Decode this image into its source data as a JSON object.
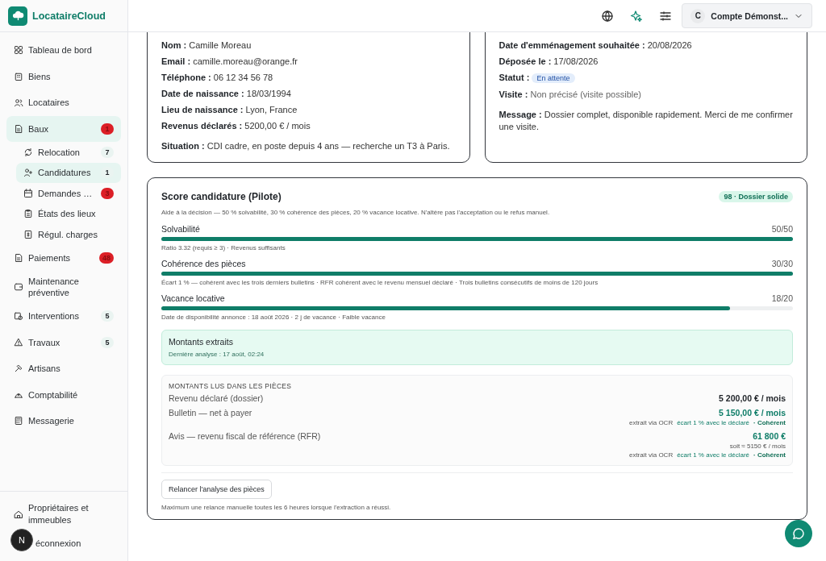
{
  "brand": {
    "name": "LocataireCloud"
  },
  "sidebar": {
    "items": [
      {
        "label": "Tableau de bord",
        "selected": false
      },
      {
        "label": "Biens",
        "selected": false
      },
      {
        "label": "Locataires",
        "selected": false
      },
      {
        "label": "Baux",
        "selected": true,
        "badge": "1",
        "alert": true,
        "children": [
          {
            "label": "Relocation",
            "selected": false,
            "badge": "7",
            "alert": false
          },
          {
            "label": "Candidatures",
            "selected": true,
            "badge": "1",
            "alert": false
          },
          {
            "label": "Demandes …",
            "selected": false,
            "badge": "3",
            "alert": true
          },
          {
            "label": "États des lieux",
            "selected": false
          },
          {
            "label": "Régul. charges",
            "selected": false
          }
        ]
      },
      {
        "label": "Paiements",
        "selected": false,
        "badge": "48",
        "alert": true
      },
      {
        "label": "Maintenance préventive",
        "selected": false
      },
      {
        "label": "Interventions",
        "selected": false,
        "badge": "5",
        "alert": false
      },
      {
        "label": "Travaux",
        "selected": false,
        "badge": "5",
        "alert": false
      },
      {
        "label": "Artisans",
        "selected": false
      },
      {
        "label": "Comptabilité",
        "selected": false
      },
      {
        "label": "Messagerie",
        "selected": false
      }
    ],
    "footer_items": [
      {
        "label": "Propriétaires et immeubles"
      },
      {
        "label": "éconnexion",
        "kind": "covered"
      }
    ]
  },
  "floating_avatar": {
    "initial": "N"
  },
  "topbar": {
    "account": {
      "initial": "C",
      "name": "Compte Démonst..."
    }
  },
  "applicant": {
    "fields": [
      {
        "label": "Nom :",
        "value": "Camille Moreau"
      },
      {
        "label": "Email :",
        "value": "camille.moreau@orange.fr"
      },
      {
        "label": "Téléphone :",
        "value": "06 12 34 56 78"
      },
      {
        "label": "Date de naissance :",
        "value": "18/03/1994"
      },
      {
        "label": "Lieu de naissance :",
        "value": "Lyon, France"
      },
      {
        "label": "Revenus déclarés :",
        "value": "5200,00 € / mois"
      },
      {
        "label": "Situation :",
        "value": "CDI cadre, en poste depuis 4 ans — recherche un T3 à Paris.",
        "kind": "spaced"
      }
    ]
  },
  "request": {
    "fields": [
      {
        "label": "Date d'emménagement souhaitée :",
        "value": "20/08/2026"
      },
      {
        "label": "Déposée le :",
        "value": "17/08/2026"
      },
      {
        "label": "Statut :",
        "value": "En attente",
        "kind": "status"
      },
      {
        "label": "Visite :",
        "value": "Non précisé (visite possible)",
        "kind": "muted"
      },
      {
        "label": "Message :",
        "value": "Dossier complet, disponible rapidement. Merci de me confirmer une visite.",
        "kind": "spaced"
      }
    ]
  },
  "score": {
    "title": "Score candidature (Pilote)",
    "badge": "98 · Dossier solide",
    "description": "Aide à la décision — 50 % solvabilité, 30 % cohérence des pièces, 20 % vacance locative. N'altère pas l'acceptation ou le refus manuel.",
    "criteria": [
      {
        "name": "Solvabilité",
        "score": "50/50",
        "level": 1,
        "detail": "Ratio 3.32 (requis ≥ 3) · Revenus suffisants"
      },
      {
        "name": "Cohérence des pièces",
        "score": "30/30",
        "level": 1,
        "detail": "Écart 1 % — cohérent avec les trois derniers bulletins · RFR cohérent avec le revenu mensuel déclaré · Trois bulletins consécutifs de moins de 120 jours"
      },
      {
        "name": "Vacance locative",
        "score": "18/20",
        "level": 0.9,
        "detail": "Date de disponibilité annonce : 18 août 2026 · 2 j de vacance · Faible vacance"
      }
    ],
    "extracted": {
      "title": "Montants extraits",
      "subtitle": "Dernière analyse : 17 août, 02:24"
    },
    "amounts": {
      "heading": "MONTANTS LUS DANS LES PIÈCES",
      "rows": [
        {
          "label": "Revenu déclaré (dossier)",
          "value": "5 200,00 € / mois",
          "kind": "declared"
        },
        {
          "label": "Bulletin — net à payer",
          "value": "5 150,00 € / mois",
          "kind": "extracted",
          "source": "extrait via OCR",
          "gap": "écart 1 % avec le déclaré",
          "verdict": "· Cohérent"
        },
        {
          "label": "Avis — revenu fiscal de référence (RFR)",
          "value": "61 800 €",
          "kind": "extracted",
          "monthly": "soit ≈ 5150 € / mois",
          "source": "extrait via OCR",
          "gap": "écart 1 % avec le déclaré",
          "verdict": "· Cohérent"
        }
      ]
    },
    "action": "Relancer l'analyse des pièces",
    "note": "Maximum une relance manuelle toutes les 6 heures lorsque l'extraction a réussi."
  }
}
